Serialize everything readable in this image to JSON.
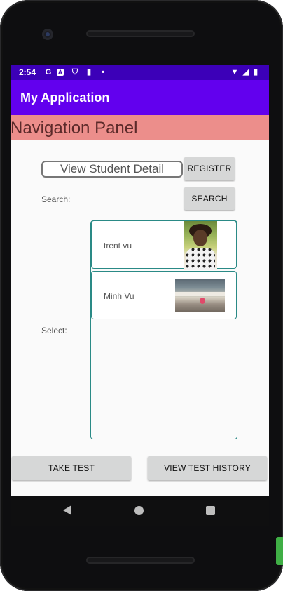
{
  "status_bar": {
    "time": "2:54",
    "icons": [
      "google-g-icon",
      "a-icon",
      "shield-icon",
      "sd-card-icon",
      "dot-icon",
      "wifi-icon",
      "signal-icon",
      "battery-icon"
    ]
  },
  "app_bar": {
    "title": "My Application"
  },
  "nav_panel": {
    "label": "Navigation Panel"
  },
  "form": {
    "view_student_detail": "View Student Detail",
    "register_label": "REGISTER",
    "search_label": "Search:",
    "search_value": "",
    "search_button": "SEARCH",
    "select_label": "Select:"
  },
  "students": [
    {
      "name": "trent vu",
      "thumb": "person-photo"
    },
    {
      "name": "Minh Vu",
      "thumb": "beach-photo"
    }
  ],
  "actions": {
    "take_test": "TAKE TEST",
    "view_history": "VIEW TEST HISTORY"
  },
  "colors": {
    "status_bar": "#3c00b8",
    "app_bar": "#6200ee",
    "nav_panel": "#ec8e8b",
    "list_border": "#2a8a86"
  }
}
